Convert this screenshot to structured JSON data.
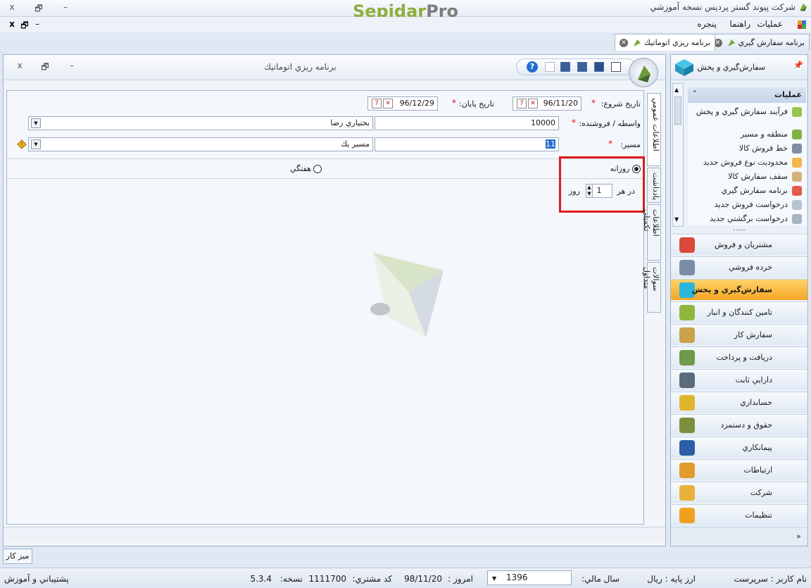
{
  "app": {
    "title": "شرکت پیوند گستر پردیس نسخه آموزشي",
    "brand_a": "Sepidar",
    "brand_b": "Pro"
  },
  "window_controls": {
    "close": "x",
    "restore": "🗗",
    "minimize": "–"
  },
  "menu": {
    "items": [
      "عمليات",
      "راهنما",
      "پنجره"
    ]
  },
  "tabs": [
    {
      "label": "برنامه سفارش گيري",
      "active": false
    },
    {
      "label": "برنامه ريزي اتوماتيك",
      "active": true
    }
  ],
  "document": {
    "title": "برنامه ريزي اتوماتيك"
  },
  "form": {
    "start_date_label": "تاريخ شروع:",
    "start_date_value": "96/11/20",
    "end_date_label": "تاريخ پايان:",
    "end_date_value": "96/12/29",
    "agent_label": "واسطه / فروشنده:",
    "agent_code": "10000",
    "agent_name": "بختياري رضا",
    "route_label": "مسير:",
    "route_code": "11",
    "route_name": "مسير يك",
    "radio_daily": "روزانه",
    "radio_weekly": "هفتگي",
    "every_label": "در هر",
    "every_value": "1",
    "day_label": "روز"
  },
  "side_tabs": [
    "اطلاعات عمومي",
    "يادداشت",
    "اطلاعات تکميلي",
    "سوالات متداول"
  ],
  "sidebar": {
    "header": "سفارش‌گيري و پخش",
    "ops_title": "عمليات",
    "ops": [
      "فرآيند سفارش گيري و پخش",
      "منطقه و مسير",
      "خط فروش کالا",
      "محدوديت نوع فروش جديد",
      "سقف سفارش کالا",
      "برنامه سفارش گيري",
      "درخواست فروش جديد",
      "درخواست برگشتي جديد"
    ],
    "modules": [
      {
        "label": "مشتريان و فروش",
        "color": "#d94a3a"
      },
      {
        "label": "خرده فروشي",
        "color": "#7a8da6"
      },
      {
        "label": "سفارش‌گيري و پخش",
        "color": "#2bb6d9",
        "active": true
      },
      {
        "label": "تامين کنندگان و انبار",
        "color": "#8fb73e"
      },
      {
        "label": "سفارش کار",
        "color": "#c9a24a"
      },
      {
        "label": "دريافت و پرداخت",
        "color": "#6f9a4b"
      },
      {
        "label": "دارايي ثابت",
        "color": "#5a6b7c"
      },
      {
        "label": "حسابداري",
        "color": "#e0b52e"
      },
      {
        "label": "حقوق و دستمزد",
        "color": "#7b8f3c"
      },
      {
        "label": "پيمانکاري",
        "color": "#2c5fa8"
      },
      {
        "label": "ارتباطات",
        "color": "#e39a2a"
      },
      {
        "label": "شرکت",
        "color": "#e8b23a"
      },
      {
        "label": "تنظيمات",
        "color": "#f0a020"
      }
    ]
  },
  "desk_button": "ميز کار",
  "status": {
    "username_label": "نام کاربر :",
    "username": "سرپرست",
    "base_currency_label": "ارز پايه :",
    "base_currency": "ريال",
    "fiscal_year_label": "سال مالي:",
    "fiscal_year": "1396",
    "today_label": "امروز :",
    "today": "98/11/20",
    "customer_code_label": "کد مشتري:",
    "customer_code": "1111700",
    "version_label": "نسخه:",
    "version": "5.3.4",
    "support": "پشتيباني و آموزش"
  }
}
